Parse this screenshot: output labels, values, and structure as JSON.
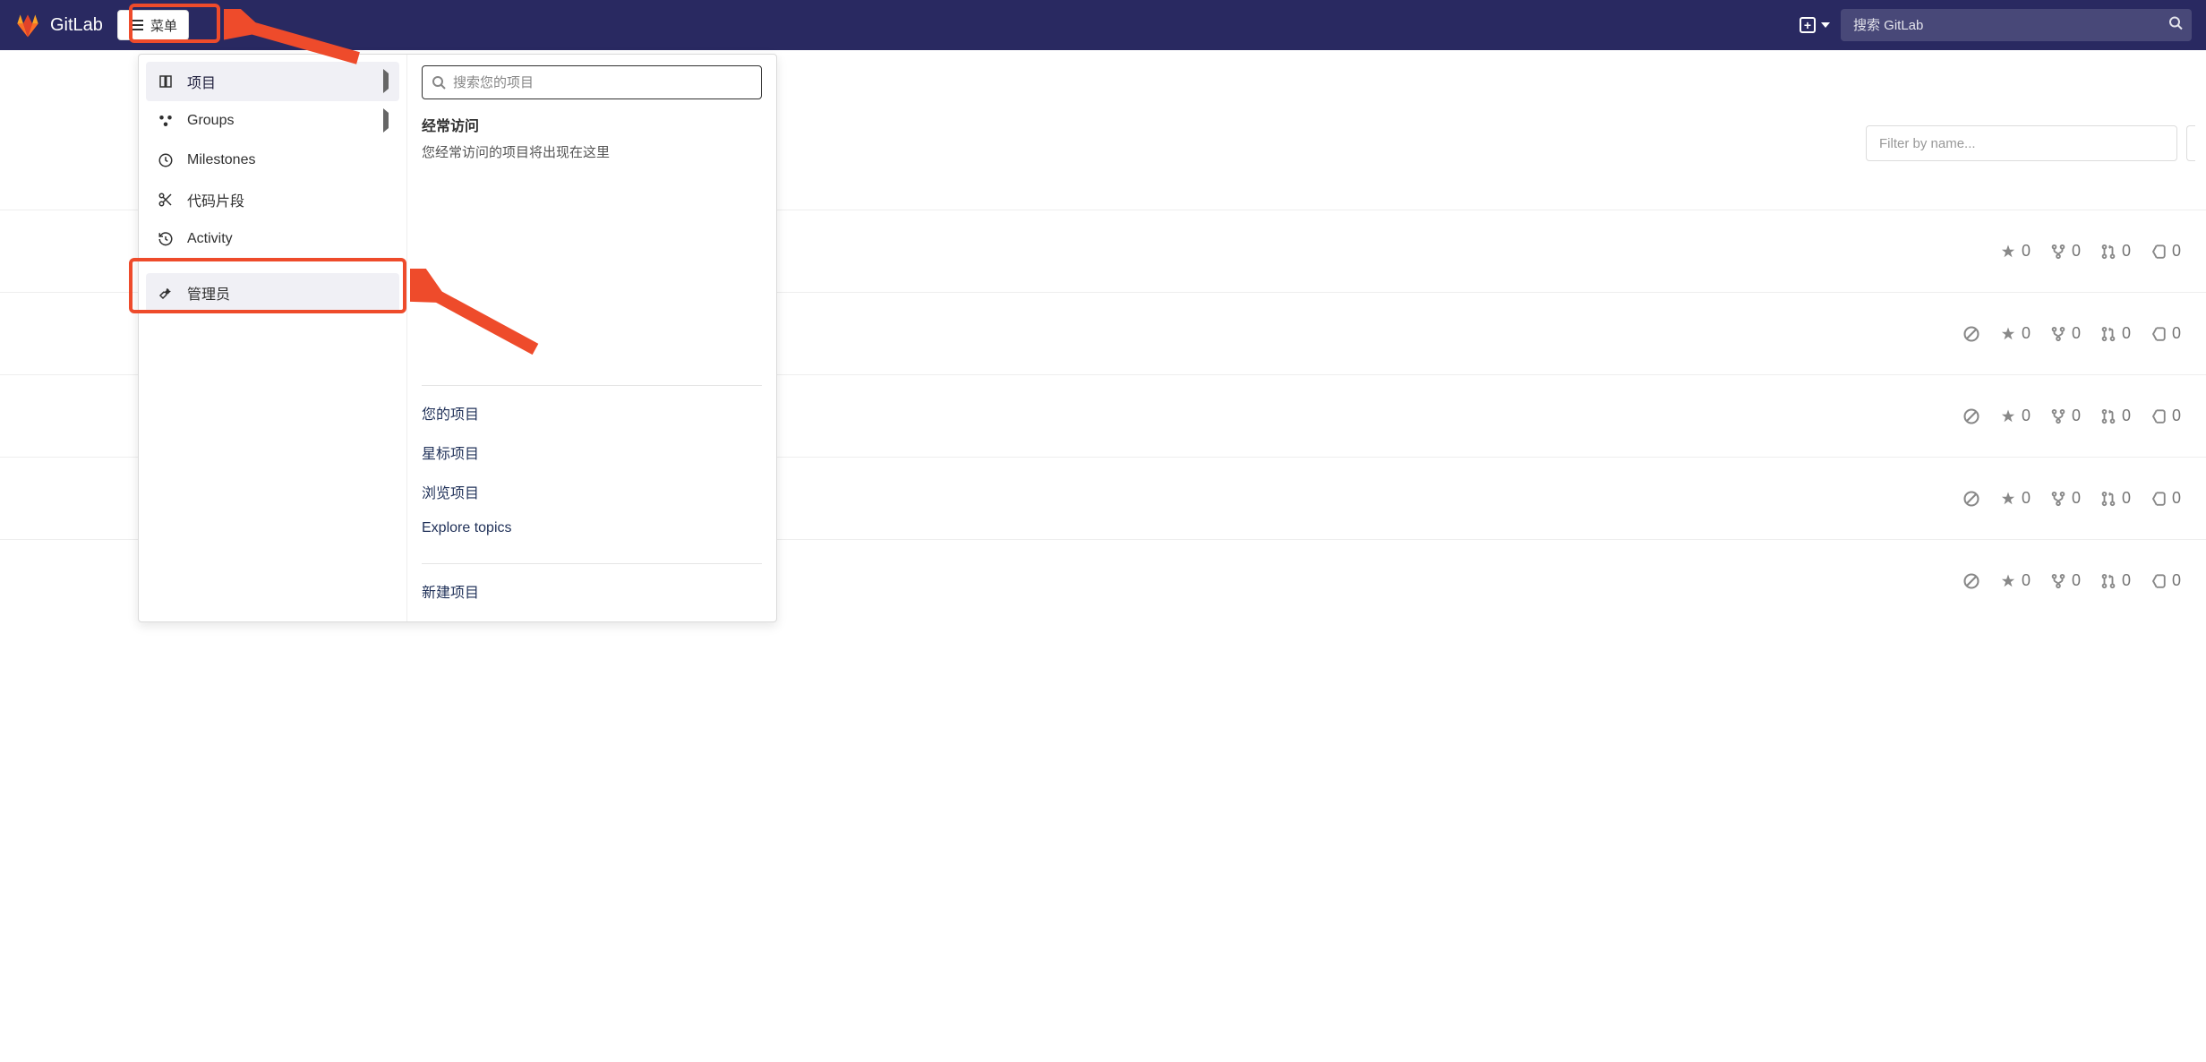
{
  "header": {
    "brand": "GitLab",
    "menu_button": "菜单",
    "search_placeholder": "搜索 GitLab"
  },
  "menu": {
    "items": [
      {
        "label": "项目",
        "icon": "book-icon",
        "active": true,
        "has_chevron": true
      },
      {
        "label": "Groups",
        "icon": "groups-icon",
        "active": false,
        "has_chevron": true
      },
      {
        "label": "Milestones",
        "icon": "clock-icon",
        "active": false,
        "has_chevron": false
      },
      {
        "label": "代码片段",
        "icon": "scissors-icon",
        "active": false,
        "has_chevron": false
      },
      {
        "label": "Activity",
        "icon": "history-icon",
        "active": false,
        "has_chevron": false
      }
    ],
    "admin": {
      "label": "管理员",
      "icon": "wrench-icon"
    },
    "right": {
      "search_placeholder": "搜索您的项目",
      "frequent_heading": "经常访问",
      "frequent_empty": "您经常访问的项目将出现在这里",
      "links": [
        "您的项目",
        "星标项目",
        "浏览项目",
        "Explore topics"
      ],
      "new_project": "新建项目"
    }
  },
  "filter": {
    "placeholder": "Filter by name..."
  },
  "stats": {
    "rows": [
      {
        "blocked": false,
        "star": 0,
        "fork": 0,
        "mr": 0,
        "issue": 0
      },
      {
        "blocked": true,
        "star": 0,
        "fork": 0,
        "mr": 0,
        "issue": 0
      },
      {
        "blocked": true,
        "star": 0,
        "fork": 0,
        "mr": 0,
        "issue": 0
      },
      {
        "blocked": true,
        "star": 0,
        "fork": 0,
        "mr": 0,
        "issue": 0
      },
      {
        "blocked": true,
        "star": 0,
        "fork": 0,
        "mr": 0,
        "issue": 0
      }
    ]
  }
}
